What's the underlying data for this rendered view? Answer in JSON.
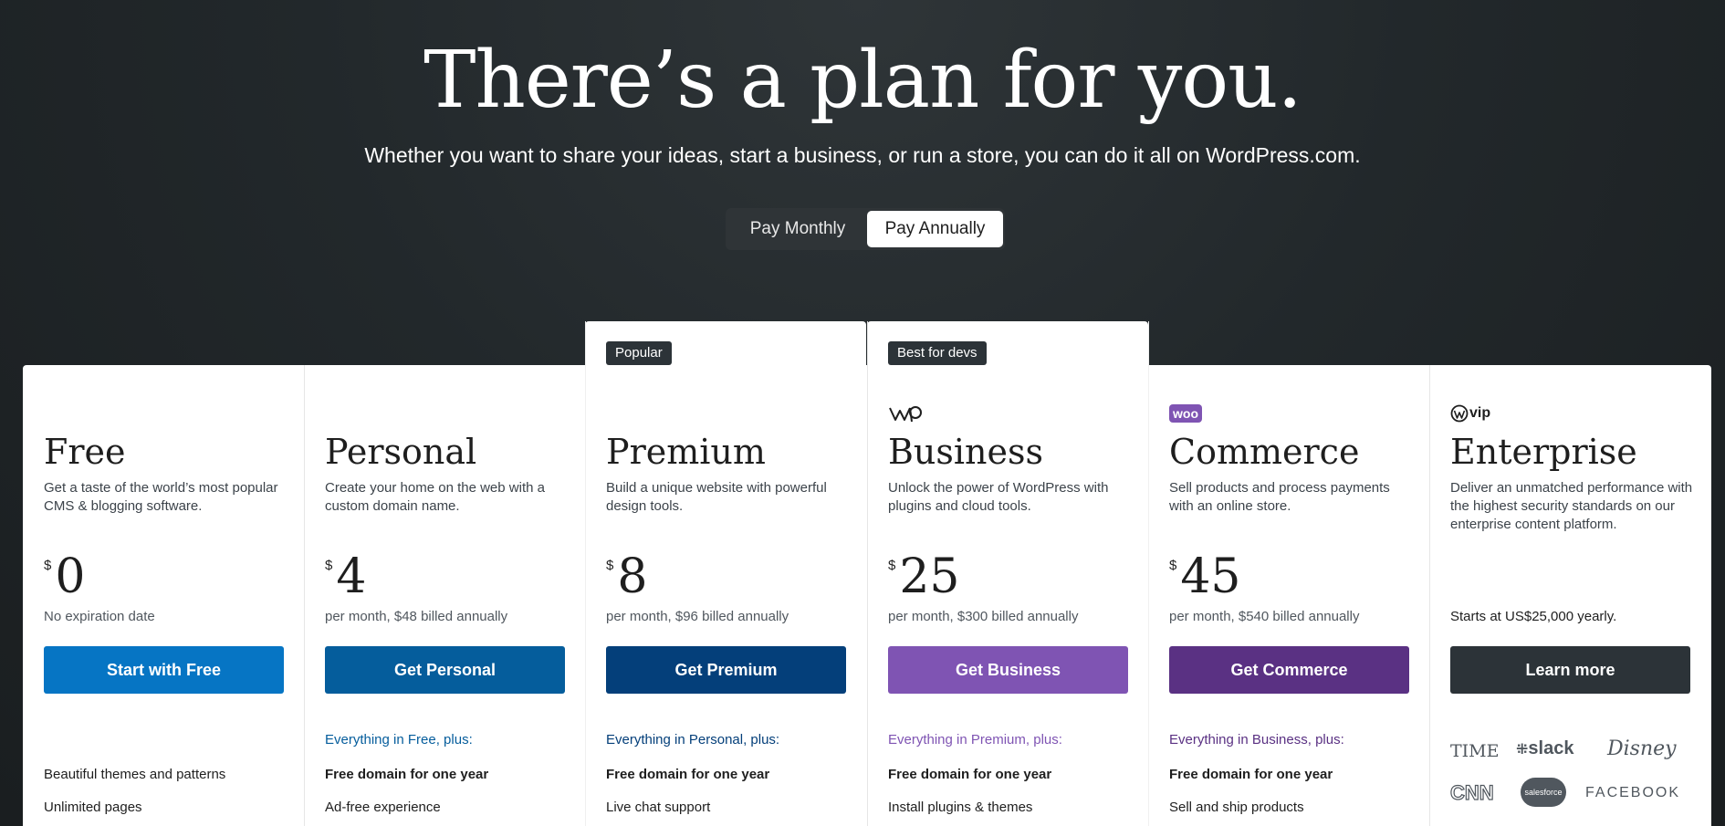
{
  "hero": {
    "title": "There’s a plan for you.",
    "subtitle": "Whether you want to share your ideas, start a business, or run a store, you can do it all on WordPress.com."
  },
  "billing_toggle": {
    "monthly_label": "Pay Monthly",
    "annually_label": "Pay Annually",
    "selected": "Pay Annually"
  },
  "plans": [
    {
      "name": "Free",
      "description": "Get a taste of the world’s most popular CMS & blogging software.",
      "currency": "$",
      "price": "0",
      "billing_note": "No expiration date",
      "cta": "Start with Free",
      "cta_color": "#0675c4",
      "features_heading": "",
      "features": [
        "Beautiful themes and patterns",
        "Unlimited pages"
      ]
    },
    {
      "name": "Personal",
      "description": "Create your home on the web with a custom domain name.",
      "currency": "$",
      "price": "4",
      "billing_note": "per month, $48 billed annually",
      "cta": "Get Personal",
      "cta_color": "#055d9c",
      "features_heading": "Everything in Free, plus:",
      "features_heading_color": "#055d9c",
      "features": [
        "Free domain for one year",
        "Ad-free experience"
      ]
    },
    {
      "name": "Premium",
      "badge": "Popular",
      "description": "Build a unique website with powerful design tools.",
      "currency": "$",
      "price": "8",
      "billing_note": "per month, $96 billed annually",
      "cta": "Get Premium",
      "cta_color": "#043f7a",
      "features_heading": "Everything in Personal, plus:",
      "features_heading_color": "#043f7a",
      "features": [
        "Free domain for one year",
        "Live chat support"
      ]
    },
    {
      "name": "Business",
      "badge": "Best for devs",
      "logo": "wp-logo-icon",
      "description": "Unlock the power of WordPress with plugins and cloud tools.",
      "currency": "$",
      "price": "25",
      "billing_note": "per month, $300 billed annually",
      "cta": "Get Business",
      "cta_color": "#7f54b3",
      "features_heading": "Everything in Premium, plus:",
      "features_heading_color": "#7f54b3",
      "features": [
        "Free domain for one year",
        "Install plugins & themes"
      ]
    },
    {
      "name": "Commerce",
      "logo": "woo-logo-icon",
      "logo_text": "woo",
      "description": "Sell products and process payments with an online store.",
      "currency": "$",
      "price": "45",
      "billing_note": "per month, $540 billed annually",
      "cta": "Get Commerce",
      "cta_color": "#5a3183",
      "features_heading": "Everything in Business, plus:",
      "features_heading_color": "#5a3183",
      "features": [
        "Free domain for one year",
        "Sell and ship products"
      ]
    },
    {
      "name": "Enterprise",
      "logo": "wpvip-logo-icon",
      "logo_text": "vip",
      "description": "Deliver an unmatched performance with the highest security standards on our enterprise content platform.",
      "billing_note": "Starts at US$25,000 yearly.",
      "cta": "Learn more",
      "cta_color": "#2c3338",
      "clients": [
        "TIME",
        "slack",
        "Disney",
        "CNN",
        "salesforce",
        "FACEBOOK"
      ]
    }
  ],
  "colors": {
    "background": "#22282b",
    "badge": "#2c3338",
    "toggle_track": "#2f3437"
  }
}
